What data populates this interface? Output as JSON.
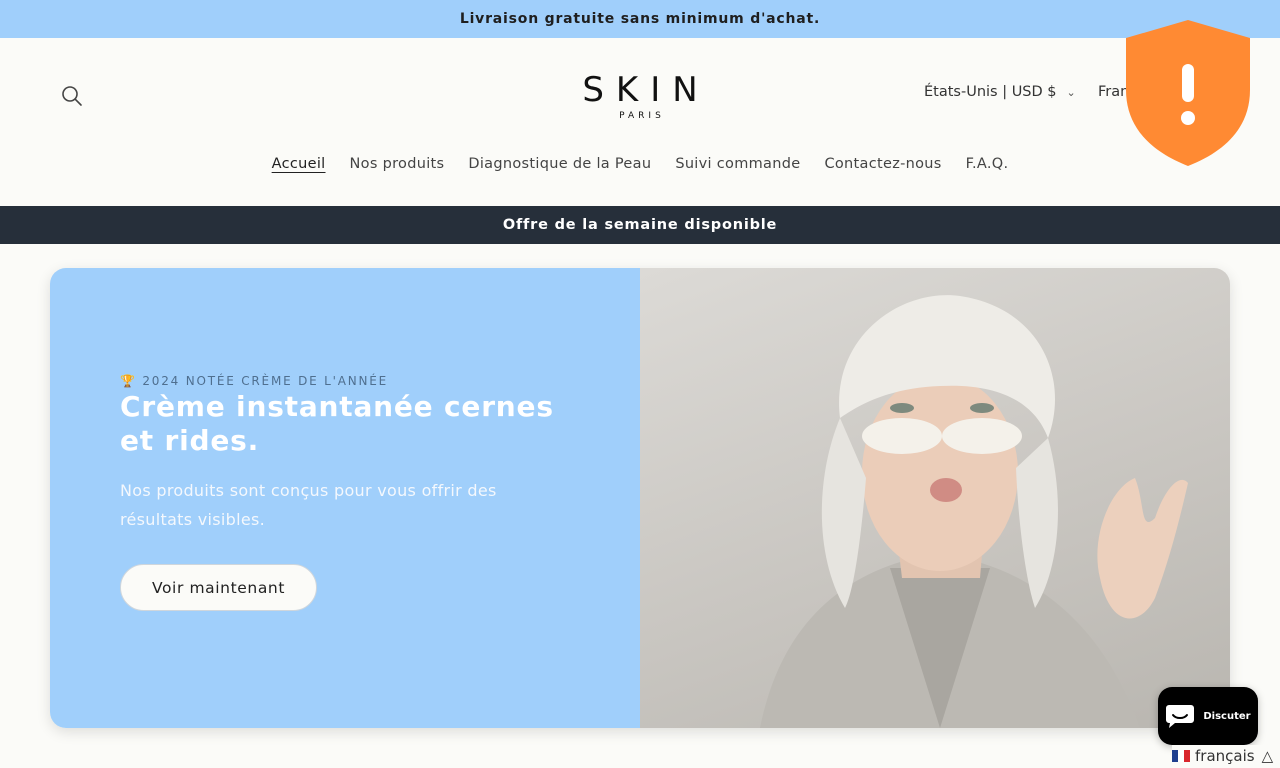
{
  "announcement": {
    "text": "Livraison gratuite sans minimum d'achat."
  },
  "header": {
    "logo": {
      "main": "SKIN",
      "sub": "PARIS"
    },
    "currency": "États-Unis | USD $",
    "language": "Fran",
    "search_icon": "search-icon"
  },
  "nav": {
    "items": [
      {
        "label": "Accueil",
        "active": true
      },
      {
        "label": "Nos produits"
      },
      {
        "label": "Diagnostique de la Peau"
      },
      {
        "label": "Suivi commande"
      },
      {
        "label": "Contactez-nous"
      },
      {
        "label": "F.A.Q."
      }
    ]
  },
  "offer_bar": {
    "text": "Offre de la semaine disponible"
  },
  "hero": {
    "kicker": "🏆 2024 NOTÉE CRÈME DE L'ANNÉE",
    "title": "Crème instantanée cernes et rides.",
    "text": "Nos produits sont conçus pour vous offrir des résultats visibles.",
    "button": "Voir maintenant",
    "background_color": "#a0cffb"
  },
  "chat": {
    "label": "Discuter"
  },
  "language_widget": {
    "label": "français"
  },
  "colors": {
    "announcement_bg": "#a0cffb",
    "offer_bar_bg": "#262f3a",
    "shield": "#ff8a33"
  }
}
